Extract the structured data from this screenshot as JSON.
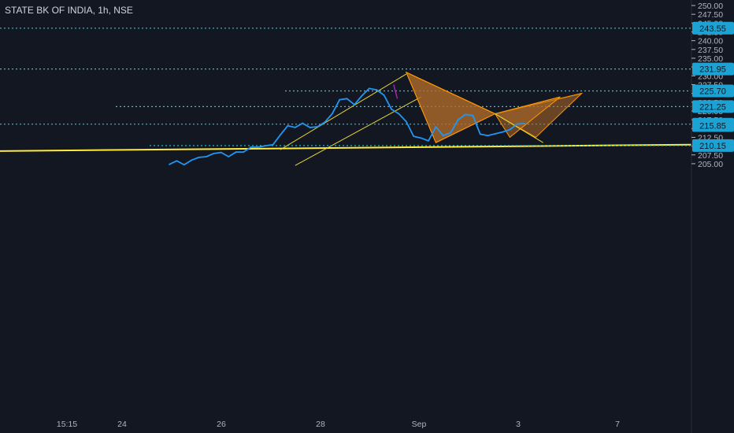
{
  "header": {
    "symbol": "STATE BK OF INDIA, 1h, NSE"
  },
  "colors": {
    "background": "#131722",
    "price_line": "#2196f3",
    "level_line": "#26c6da",
    "trend_line": "#ffeb3b",
    "channel": "#e6d83a",
    "pattern_stroke": "#ff9800",
    "pattern_fill": "#b06b2a",
    "label_bg": "#1ca3d4",
    "axis_text": "#b2b5be",
    "vertical_mark": "#9c27b0"
  },
  "chart_data": {
    "type": "line",
    "title": "STATE BK OF INDIA, 1h, NSE",
    "xlabel": "",
    "ylabel": "",
    "ylim": [
      204,
      251
    ],
    "grid": false,
    "y_ticks": [
      "205.00",
      "207.50",
      "210.00",
      "212.50",
      "215.00",
      "217.50",
      "220.00",
      "222.50",
      "225.00",
      "227.50",
      "230.00",
      "232.50",
      "235.00",
      "237.50",
      "240.00",
      "242.50",
      "245.00",
      "247.50",
      "250.00"
    ],
    "x_ticks": [
      "15:15",
      "24",
      "26",
      "28",
      "Sep",
      "3",
      "7"
    ],
    "series": [
      {
        "values": [
          [
            0,
            204.8
          ],
          [
            1,
            205.8
          ],
          [
            2,
            204.7
          ],
          [
            3,
            206.0
          ],
          [
            4,
            206.8
          ],
          [
            5,
            207.0
          ],
          [
            6,
            207.9
          ],
          [
            7,
            208.2
          ],
          [
            8,
            207.0
          ],
          [
            9,
            208.3
          ],
          [
            10,
            208.3
          ],
          [
            11,
            209.7
          ],
          [
            12,
            209.7
          ],
          [
            13,
            210.1
          ],
          [
            14,
            210.4
          ],
          [
            15,
            213.2
          ],
          [
            16,
            215.8
          ],
          [
            17,
            215.3
          ],
          [
            18,
            216.5
          ],
          [
            19,
            215.3
          ],
          [
            20,
            215.5
          ],
          [
            21,
            216.8
          ],
          [
            22,
            219.2
          ],
          [
            23,
            223.2
          ],
          [
            24,
            223.5
          ],
          [
            25,
            221.8
          ],
          [
            26,
            224.3
          ],
          [
            27,
            226.4
          ],
          [
            28,
            226.0
          ],
          [
            29,
            224.5
          ],
          [
            30,
            220.5
          ],
          [
            31,
            219.2
          ],
          [
            32,
            217.0
          ],
          [
            33,
            212.8
          ],
          [
            34,
            212.3
          ],
          [
            35,
            211.5
          ],
          [
            36,
            215.5
          ],
          [
            37,
            213.0
          ],
          [
            38,
            213.8
          ],
          [
            39,
            217.5
          ],
          [
            40,
            219.0
          ],
          [
            41,
            218.7
          ],
          [
            42,
            213.4
          ],
          [
            43,
            213.0
          ],
          [
            44,
            213.5
          ],
          [
            45,
            214.0
          ],
          [
            46,
            214.7
          ],
          [
            47,
            216.3
          ],
          [
            48,
            216.4
          ]
        ]
      }
    ],
    "price_levels": [
      "243.55",
      "231.95",
      "225.70",
      "221.25",
      "216.25",
      "215.85",
      "210.15"
    ],
    "trendline": {
      "from": [
        -33,
        208.4
      ],
      "to": [
        85,
        210.7
      ]
    },
    "channel": {
      "upper": [
        [
          15,
          209.0
        ],
        [
          32,
          230.5
        ]
      ],
      "lower": [
        [
          17,
          204.5
        ],
        [
          34,
          224.0
        ]
      ]
    },
    "pattern_1": {
      "X": [
        32.0,
        231.0
      ],
      "A": [
        36.0,
        211.0
      ],
      "B": [
        44.0,
        219.2
      ],
      "C": [
        49.5,
        212.5
      ],
      "D": [
        55.7,
        225.0
      ]
    },
    "pattern_2": {
      "X": [
        32.0,
        231.0
      ],
      "A": [
        36.0,
        211.0
      ],
      "B": [
        44.0,
        219.2
      ],
      "C": [
        46.0,
        212.5
      ],
      "D": [
        52.8,
        224.0
      ]
    },
    "projection_line": [
      [
        44,
        219.2
      ],
      [
        50.5,
        211.0
      ]
    ],
    "annotations": []
  }
}
